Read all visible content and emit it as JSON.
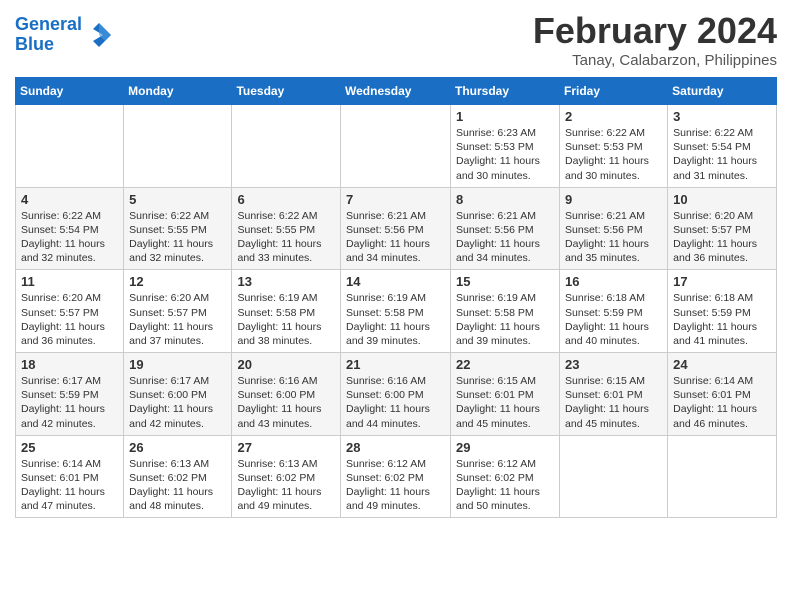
{
  "header": {
    "logo_line1": "General",
    "logo_line2": "Blue",
    "month": "February 2024",
    "location": "Tanay, Calabarzon, Philippines"
  },
  "days_of_week": [
    "Sunday",
    "Monday",
    "Tuesday",
    "Wednesday",
    "Thursday",
    "Friday",
    "Saturday"
  ],
  "weeks": [
    [
      {
        "day": "",
        "info": ""
      },
      {
        "day": "",
        "info": ""
      },
      {
        "day": "",
        "info": ""
      },
      {
        "day": "",
        "info": ""
      },
      {
        "day": "1",
        "info": "Sunrise: 6:23 AM\nSunset: 5:53 PM\nDaylight: 11 hours and 30 minutes."
      },
      {
        "day": "2",
        "info": "Sunrise: 6:22 AM\nSunset: 5:53 PM\nDaylight: 11 hours and 30 minutes."
      },
      {
        "day": "3",
        "info": "Sunrise: 6:22 AM\nSunset: 5:54 PM\nDaylight: 11 hours and 31 minutes."
      }
    ],
    [
      {
        "day": "4",
        "info": "Sunrise: 6:22 AM\nSunset: 5:54 PM\nDaylight: 11 hours and 32 minutes."
      },
      {
        "day": "5",
        "info": "Sunrise: 6:22 AM\nSunset: 5:55 PM\nDaylight: 11 hours and 32 minutes."
      },
      {
        "day": "6",
        "info": "Sunrise: 6:22 AM\nSunset: 5:55 PM\nDaylight: 11 hours and 33 minutes."
      },
      {
        "day": "7",
        "info": "Sunrise: 6:21 AM\nSunset: 5:56 PM\nDaylight: 11 hours and 34 minutes."
      },
      {
        "day": "8",
        "info": "Sunrise: 6:21 AM\nSunset: 5:56 PM\nDaylight: 11 hours and 34 minutes."
      },
      {
        "day": "9",
        "info": "Sunrise: 6:21 AM\nSunset: 5:56 PM\nDaylight: 11 hours and 35 minutes."
      },
      {
        "day": "10",
        "info": "Sunrise: 6:20 AM\nSunset: 5:57 PM\nDaylight: 11 hours and 36 minutes."
      }
    ],
    [
      {
        "day": "11",
        "info": "Sunrise: 6:20 AM\nSunset: 5:57 PM\nDaylight: 11 hours and 36 minutes."
      },
      {
        "day": "12",
        "info": "Sunrise: 6:20 AM\nSunset: 5:57 PM\nDaylight: 11 hours and 37 minutes."
      },
      {
        "day": "13",
        "info": "Sunrise: 6:19 AM\nSunset: 5:58 PM\nDaylight: 11 hours and 38 minutes."
      },
      {
        "day": "14",
        "info": "Sunrise: 6:19 AM\nSunset: 5:58 PM\nDaylight: 11 hours and 39 minutes."
      },
      {
        "day": "15",
        "info": "Sunrise: 6:19 AM\nSunset: 5:58 PM\nDaylight: 11 hours and 39 minutes."
      },
      {
        "day": "16",
        "info": "Sunrise: 6:18 AM\nSunset: 5:59 PM\nDaylight: 11 hours and 40 minutes."
      },
      {
        "day": "17",
        "info": "Sunrise: 6:18 AM\nSunset: 5:59 PM\nDaylight: 11 hours and 41 minutes."
      }
    ],
    [
      {
        "day": "18",
        "info": "Sunrise: 6:17 AM\nSunset: 5:59 PM\nDaylight: 11 hours and 42 minutes."
      },
      {
        "day": "19",
        "info": "Sunrise: 6:17 AM\nSunset: 6:00 PM\nDaylight: 11 hours and 42 minutes."
      },
      {
        "day": "20",
        "info": "Sunrise: 6:16 AM\nSunset: 6:00 PM\nDaylight: 11 hours and 43 minutes."
      },
      {
        "day": "21",
        "info": "Sunrise: 6:16 AM\nSunset: 6:00 PM\nDaylight: 11 hours and 44 minutes."
      },
      {
        "day": "22",
        "info": "Sunrise: 6:15 AM\nSunset: 6:01 PM\nDaylight: 11 hours and 45 minutes."
      },
      {
        "day": "23",
        "info": "Sunrise: 6:15 AM\nSunset: 6:01 PM\nDaylight: 11 hours and 45 minutes."
      },
      {
        "day": "24",
        "info": "Sunrise: 6:14 AM\nSunset: 6:01 PM\nDaylight: 11 hours and 46 minutes."
      }
    ],
    [
      {
        "day": "25",
        "info": "Sunrise: 6:14 AM\nSunset: 6:01 PM\nDaylight: 11 hours and 47 minutes."
      },
      {
        "day": "26",
        "info": "Sunrise: 6:13 AM\nSunset: 6:02 PM\nDaylight: 11 hours and 48 minutes."
      },
      {
        "day": "27",
        "info": "Sunrise: 6:13 AM\nSunset: 6:02 PM\nDaylight: 11 hours and 49 minutes."
      },
      {
        "day": "28",
        "info": "Sunrise: 6:12 AM\nSunset: 6:02 PM\nDaylight: 11 hours and 49 minutes."
      },
      {
        "day": "29",
        "info": "Sunrise: 6:12 AM\nSunset: 6:02 PM\nDaylight: 11 hours and 50 minutes."
      },
      {
        "day": "",
        "info": ""
      },
      {
        "day": "",
        "info": ""
      }
    ]
  ]
}
